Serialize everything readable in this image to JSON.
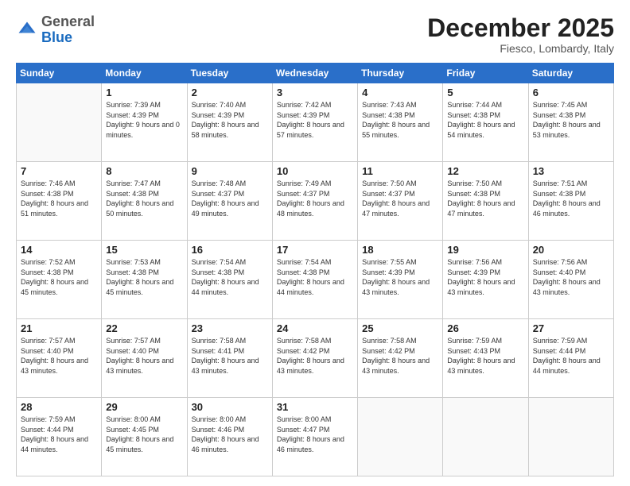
{
  "header": {
    "logo_general": "General",
    "logo_blue": "Blue",
    "month": "December 2025",
    "location": "Fiesco, Lombardy, Italy"
  },
  "days_of_week": [
    "Sunday",
    "Monday",
    "Tuesday",
    "Wednesday",
    "Thursday",
    "Friday",
    "Saturday"
  ],
  "weeks": [
    [
      {
        "num": "",
        "sunrise": "",
        "sunset": "",
        "daylight": ""
      },
      {
        "num": "1",
        "sunrise": "Sunrise: 7:39 AM",
        "sunset": "Sunset: 4:39 PM",
        "daylight": "Daylight: 9 hours and 0 minutes."
      },
      {
        "num": "2",
        "sunrise": "Sunrise: 7:40 AM",
        "sunset": "Sunset: 4:39 PM",
        "daylight": "Daylight: 8 hours and 58 minutes."
      },
      {
        "num": "3",
        "sunrise": "Sunrise: 7:42 AM",
        "sunset": "Sunset: 4:39 PM",
        "daylight": "Daylight: 8 hours and 57 minutes."
      },
      {
        "num": "4",
        "sunrise": "Sunrise: 7:43 AM",
        "sunset": "Sunset: 4:38 PM",
        "daylight": "Daylight: 8 hours and 55 minutes."
      },
      {
        "num": "5",
        "sunrise": "Sunrise: 7:44 AM",
        "sunset": "Sunset: 4:38 PM",
        "daylight": "Daylight: 8 hours and 54 minutes."
      },
      {
        "num": "6",
        "sunrise": "Sunrise: 7:45 AM",
        "sunset": "Sunset: 4:38 PM",
        "daylight": "Daylight: 8 hours and 53 minutes."
      }
    ],
    [
      {
        "num": "7",
        "sunrise": "Sunrise: 7:46 AM",
        "sunset": "Sunset: 4:38 PM",
        "daylight": "Daylight: 8 hours and 51 minutes."
      },
      {
        "num": "8",
        "sunrise": "Sunrise: 7:47 AM",
        "sunset": "Sunset: 4:38 PM",
        "daylight": "Daylight: 8 hours and 50 minutes."
      },
      {
        "num": "9",
        "sunrise": "Sunrise: 7:48 AM",
        "sunset": "Sunset: 4:37 PM",
        "daylight": "Daylight: 8 hours and 49 minutes."
      },
      {
        "num": "10",
        "sunrise": "Sunrise: 7:49 AM",
        "sunset": "Sunset: 4:37 PM",
        "daylight": "Daylight: 8 hours and 48 minutes."
      },
      {
        "num": "11",
        "sunrise": "Sunrise: 7:50 AM",
        "sunset": "Sunset: 4:37 PM",
        "daylight": "Daylight: 8 hours and 47 minutes."
      },
      {
        "num": "12",
        "sunrise": "Sunrise: 7:50 AM",
        "sunset": "Sunset: 4:38 PM",
        "daylight": "Daylight: 8 hours and 47 minutes."
      },
      {
        "num": "13",
        "sunrise": "Sunrise: 7:51 AM",
        "sunset": "Sunset: 4:38 PM",
        "daylight": "Daylight: 8 hours and 46 minutes."
      }
    ],
    [
      {
        "num": "14",
        "sunrise": "Sunrise: 7:52 AM",
        "sunset": "Sunset: 4:38 PM",
        "daylight": "Daylight: 8 hours and 45 minutes."
      },
      {
        "num": "15",
        "sunrise": "Sunrise: 7:53 AM",
        "sunset": "Sunset: 4:38 PM",
        "daylight": "Daylight: 8 hours and 45 minutes."
      },
      {
        "num": "16",
        "sunrise": "Sunrise: 7:54 AM",
        "sunset": "Sunset: 4:38 PM",
        "daylight": "Daylight: 8 hours and 44 minutes."
      },
      {
        "num": "17",
        "sunrise": "Sunrise: 7:54 AM",
        "sunset": "Sunset: 4:38 PM",
        "daylight": "Daylight: 8 hours and 44 minutes."
      },
      {
        "num": "18",
        "sunrise": "Sunrise: 7:55 AM",
        "sunset": "Sunset: 4:39 PM",
        "daylight": "Daylight: 8 hours and 43 minutes."
      },
      {
        "num": "19",
        "sunrise": "Sunrise: 7:56 AM",
        "sunset": "Sunset: 4:39 PM",
        "daylight": "Daylight: 8 hours and 43 minutes."
      },
      {
        "num": "20",
        "sunrise": "Sunrise: 7:56 AM",
        "sunset": "Sunset: 4:40 PM",
        "daylight": "Daylight: 8 hours and 43 minutes."
      }
    ],
    [
      {
        "num": "21",
        "sunrise": "Sunrise: 7:57 AM",
        "sunset": "Sunset: 4:40 PM",
        "daylight": "Daylight: 8 hours and 43 minutes."
      },
      {
        "num": "22",
        "sunrise": "Sunrise: 7:57 AM",
        "sunset": "Sunset: 4:40 PM",
        "daylight": "Daylight: 8 hours and 43 minutes."
      },
      {
        "num": "23",
        "sunrise": "Sunrise: 7:58 AM",
        "sunset": "Sunset: 4:41 PM",
        "daylight": "Daylight: 8 hours and 43 minutes."
      },
      {
        "num": "24",
        "sunrise": "Sunrise: 7:58 AM",
        "sunset": "Sunset: 4:42 PM",
        "daylight": "Daylight: 8 hours and 43 minutes."
      },
      {
        "num": "25",
        "sunrise": "Sunrise: 7:58 AM",
        "sunset": "Sunset: 4:42 PM",
        "daylight": "Daylight: 8 hours and 43 minutes."
      },
      {
        "num": "26",
        "sunrise": "Sunrise: 7:59 AM",
        "sunset": "Sunset: 4:43 PM",
        "daylight": "Daylight: 8 hours and 43 minutes."
      },
      {
        "num": "27",
        "sunrise": "Sunrise: 7:59 AM",
        "sunset": "Sunset: 4:44 PM",
        "daylight": "Daylight: 8 hours and 44 minutes."
      }
    ],
    [
      {
        "num": "28",
        "sunrise": "Sunrise: 7:59 AM",
        "sunset": "Sunset: 4:44 PM",
        "daylight": "Daylight: 8 hours and 44 minutes."
      },
      {
        "num": "29",
        "sunrise": "Sunrise: 8:00 AM",
        "sunset": "Sunset: 4:45 PM",
        "daylight": "Daylight: 8 hours and 45 minutes."
      },
      {
        "num": "30",
        "sunrise": "Sunrise: 8:00 AM",
        "sunset": "Sunset: 4:46 PM",
        "daylight": "Daylight: 8 hours and 46 minutes."
      },
      {
        "num": "31",
        "sunrise": "Sunrise: 8:00 AM",
        "sunset": "Sunset: 4:47 PM",
        "daylight": "Daylight: 8 hours and 46 minutes."
      },
      {
        "num": "",
        "sunrise": "",
        "sunset": "",
        "daylight": ""
      },
      {
        "num": "",
        "sunrise": "",
        "sunset": "",
        "daylight": ""
      },
      {
        "num": "",
        "sunrise": "",
        "sunset": "",
        "daylight": ""
      }
    ]
  ]
}
